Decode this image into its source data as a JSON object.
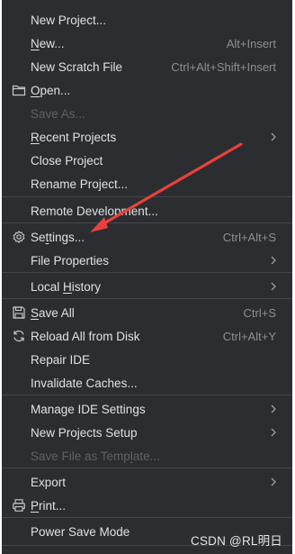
{
  "menu": {
    "items": [
      {
        "label": "New Project...",
        "pre": "",
        "u": "",
        "post": "New Project...",
        "shortcut": "",
        "submenu": false,
        "disabled": false,
        "icon": ""
      },
      {
        "label": "New...",
        "pre": "",
        "u": "N",
        "post": "ew...",
        "shortcut": "Alt+Insert",
        "submenu": false,
        "disabled": false,
        "icon": ""
      },
      {
        "label": "New Scratch File",
        "pre": "",
        "u": "",
        "post": "New Scratch File",
        "shortcut": "Ctrl+Alt+Shift+Insert",
        "submenu": false,
        "disabled": false,
        "icon": ""
      },
      {
        "label": "Open...",
        "pre": "",
        "u": "O",
        "post": "pen...",
        "shortcut": "",
        "submenu": false,
        "disabled": false,
        "icon": "folder-icon"
      },
      {
        "label": "Save As...",
        "pre": "",
        "u": "",
        "post": "Save As...",
        "shortcut": "",
        "submenu": false,
        "disabled": true,
        "icon": ""
      },
      {
        "label": "Recent Projects",
        "pre": "",
        "u": "R",
        "post": "ecent Projects",
        "shortcut": "",
        "submenu": true,
        "disabled": false,
        "icon": ""
      },
      {
        "label": "Close Project",
        "pre": "",
        "u": "",
        "post": "Close Project",
        "shortcut": "",
        "submenu": false,
        "disabled": false,
        "icon": ""
      },
      {
        "label": "Rename Project...",
        "pre": "",
        "u": "",
        "post": "Rename Project...",
        "shortcut": "",
        "submenu": false,
        "disabled": false,
        "icon": ""
      },
      {
        "label": "Remote Development...",
        "pre": "",
        "u": "",
        "post": "Remote Development...",
        "shortcut": "",
        "submenu": false,
        "disabled": false,
        "icon": ""
      },
      {
        "label": "Settings...",
        "pre": "Se",
        "u": "t",
        "post": "tings...",
        "shortcut": "Ctrl+Alt+S",
        "submenu": false,
        "disabled": false,
        "icon": "gear-icon"
      },
      {
        "label": "File Properties",
        "pre": "",
        "u": "",
        "post": "File Properties",
        "shortcut": "",
        "submenu": true,
        "disabled": false,
        "icon": ""
      },
      {
        "label": "Local History",
        "pre": "Local ",
        "u": "H",
        "post": "istory",
        "shortcut": "",
        "submenu": true,
        "disabled": false,
        "icon": ""
      },
      {
        "label": "Save All",
        "pre": "",
        "u": "S",
        "post": "ave All",
        "shortcut": "Ctrl+S",
        "submenu": false,
        "disabled": false,
        "icon": "save-icon"
      },
      {
        "label": "Reload All from Disk",
        "pre": "",
        "u": "",
        "post": "Reload All from Disk",
        "shortcut": "Ctrl+Alt+Y",
        "submenu": false,
        "disabled": false,
        "icon": "reload-icon"
      },
      {
        "label": "Repair IDE",
        "pre": "",
        "u": "",
        "post": "Repair IDE",
        "shortcut": "",
        "submenu": false,
        "disabled": false,
        "icon": ""
      },
      {
        "label": "Invalidate Caches...",
        "pre": "",
        "u": "",
        "post": "Invalidate Caches...",
        "shortcut": "",
        "submenu": false,
        "disabled": false,
        "icon": ""
      },
      {
        "label": "Manage IDE Settings",
        "pre": "",
        "u": "",
        "post": "Manage IDE Settings",
        "shortcut": "",
        "submenu": true,
        "disabled": false,
        "icon": ""
      },
      {
        "label": "New Projects Setup",
        "pre": "",
        "u": "",
        "post": "New Projects Setup",
        "shortcut": "",
        "submenu": true,
        "disabled": false,
        "icon": ""
      },
      {
        "label": "Save File as Template...",
        "pre": "Save File as Temp",
        "u": "l",
        "post": "ate...",
        "shortcut": "",
        "submenu": false,
        "disabled": true,
        "icon": ""
      },
      {
        "label": "Export",
        "pre": "",
        "u": "",
        "post": "Export",
        "shortcut": "",
        "submenu": true,
        "disabled": false,
        "icon": ""
      },
      {
        "label": "Print...",
        "pre": "",
        "u": "P",
        "post": "rint...",
        "shortcut": "",
        "submenu": false,
        "disabled": false,
        "icon": "print-icon"
      },
      {
        "label": "Power Save Mode",
        "pre": "",
        "u": "",
        "post": "Power Save Mode",
        "shortcut": "",
        "submenu": false,
        "disabled": false,
        "icon": ""
      }
    ]
  },
  "watermark": "CSDN @RL明日",
  "colors": {
    "menu_bg": "#2b2d30",
    "text": "#dfe1e5",
    "disabled": "#5e6166",
    "shortcut": "#8c8f94",
    "separator": "#43454a",
    "annotation_arrow": "#e8413a"
  }
}
